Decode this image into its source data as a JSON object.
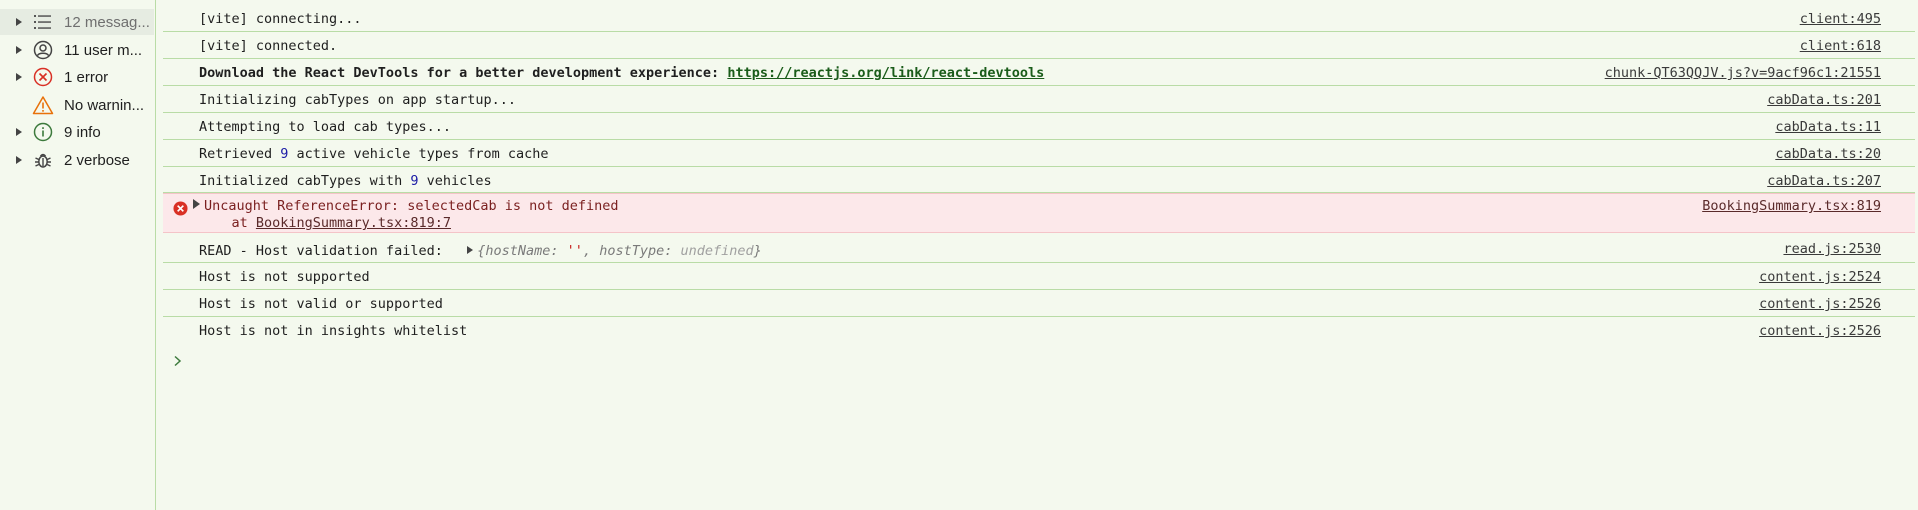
{
  "sidebar": {
    "items": [
      {
        "label": "12 messag...",
        "icon": "list-icon",
        "expandable": true,
        "selected": true
      },
      {
        "label": "11 user m...",
        "icon": "user-icon",
        "expandable": true,
        "selected": false
      },
      {
        "label": "1 error",
        "icon": "error-icon",
        "expandable": true,
        "selected": false
      },
      {
        "label": "No warnin...",
        "icon": "warning-icon",
        "expandable": false,
        "selected": false
      },
      {
        "label": "9 info",
        "icon": "info-icon",
        "expandable": true,
        "selected": false
      },
      {
        "label": "2 verbose",
        "icon": "bug-icon",
        "expandable": true,
        "selected": false
      }
    ]
  },
  "console": {
    "rows": [
      {
        "text": "[vite] connecting...",
        "source": "client:495"
      },
      {
        "text": "[vite] connected.",
        "source": "client:618"
      },
      {
        "text": "Download the React DevTools for a better development experience: ",
        "link": "https://reactjs.org/link/react-devtools",
        "source": "chunk-QT63QQJV.js?v=9acf96c1:21551"
      },
      {
        "text": "Initializing cabTypes on app startup...",
        "source": "cabData.ts:201"
      },
      {
        "text": "Attempting to load cab types...",
        "source": "cabData.ts:11"
      },
      {
        "text_before": "Retrieved ",
        "number": "9",
        "text_after": " active vehicle types from cache",
        "source": "cabData.ts:20"
      },
      {
        "text_before": "Initialized cabTypes with ",
        "number": "9",
        "text_after": " vehicles",
        "source": "cabData.ts:207"
      }
    ],
    "error": {
      "message": "Uncaught ReferenceError: selectedCab is not defined",
      "at_prefix": "    at ",
      "at_link": "BookingSummary.tsx:819:7",
      "source": "BookingSummary.tsx:819"
    },
    "object_row": {
      "label": "READ - Host validation failed:",
      "obj_open": "{",
      "key1": "hostName",
      "colon1": ": ",
      "val1": "''",
      "sep": ", ",
      "key2": "hostType",
      "colon2": ": ",
      "val2": "undefined",
      "obj_close": "}",
      "source": "read.js:2530"
    },
    "tail_rows": [
      {
        "text": "Host is not supported",
        "source": "content.js:2524"
      },
      {
        "text": "Host is not valid or supported",
        "source": "content.js:2526"
      },
      {
        "text": "Host is not in insights whitelist",
        "source": "content.js:2526"
      }
    ],
    "prompt_glyph": "›"
  },
  "colors": {
    "background": "#f4f9ee",
    "divider": "#b9dca6",
    "error_bg": "#fce8ea",
    "error_icon": "#d93025",
    "warning_icon": "#e8710a",
    "info_icon": "#3c7a3c"
  }
}
